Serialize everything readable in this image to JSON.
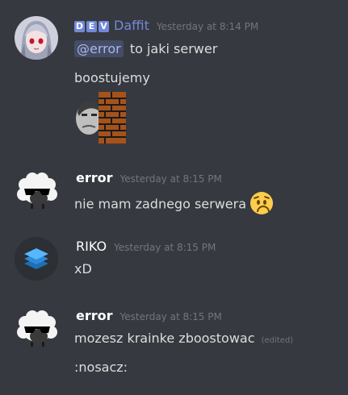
{
  "messages": [
    {
      "author": "Daffit",
      "tag_letters": [
        "D",
        "E",
        "V"
      ],
      "timestamp": "Yesterday at 8:14 PM",
      "mention": "@error",
      "line1_rest": "to jaki serwer",
      "line2": "boostujemy",
      "custom_emoji": "face-with-brick-wall-emoji"
    },
    {
      "author": "error",
      "timestamp": "Yesterday at 8:15 PM",
      "text": "nie mam zadnego serwera",
      "emoji": "worried-face-emoji"
    },
    {
      "author": "RIKO",
      "timestamp": "Yesterday at 8:15 PM",
      "text": "xD"
    },
    {
      "author": "error",
      "timestamp": "Yesterday at 8:15 PM",
      "text": "mozesz krainke zboostowac",
      "edited": "(edited)",
      "line2": ":nosacz:"
    }
  ],
  "colors": {
    "background": "#36393f",
    "mention_accent": "#7289da",
    "text": "#dcddde",
    "muted": "#72767d"
  }
}
